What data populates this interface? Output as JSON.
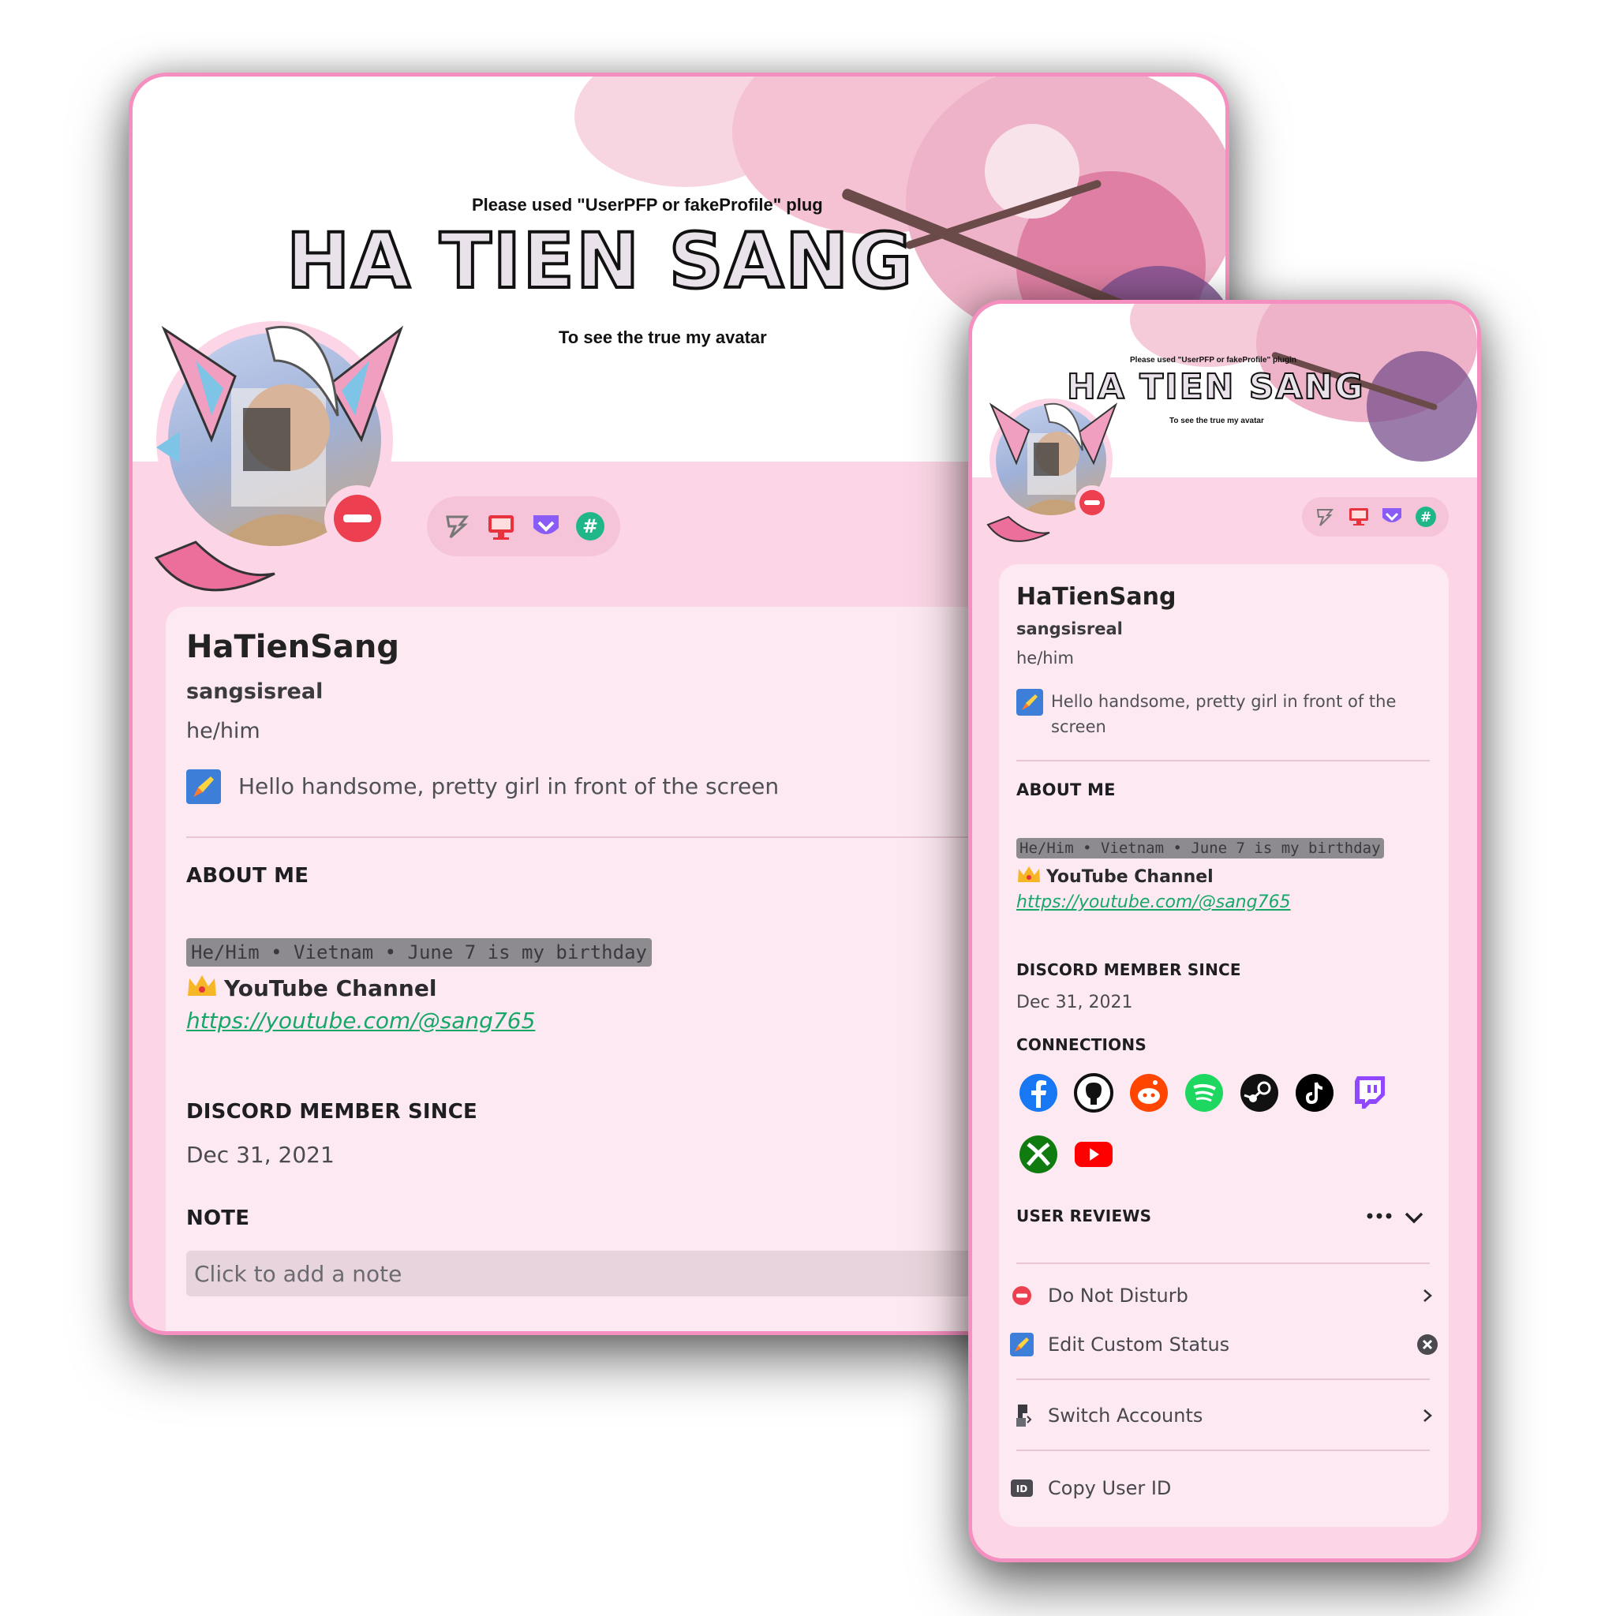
{
  "banner": {
    "caption_top": "Please used \"UserPFP or fakeProfile\" plug",
    "title": "HA TIEN SANG",
    "caption_bottom": "To see the true my avatar",
    "small_caption_top": "Please used \"UserPFP or fakeProfile\" plugin",
    "small_title": "HA TIEN SANG",
    "small_caption_bottom": "To see the true my avatar"
  },
  "profile": {
    "display_name": "HaTienSang",
    "username": "sangsisreal",
    "pronouns": "he/him",
    "custom_status": "Hello handsome, pretty girl in front of the screen",
    "status": "Do Not Disturb"
  },
  "badges": [
    "hypesquad-badge-icon",
    "nitro-desktop-icon",
    "shield-badge-icon",
    "hashtag-badge-icon"
  ],
  "about": {
    "heading": "ABOUT ME",
    "code_line": "He/Him • Vietnam • June 7 is my birthday",
    "yt_label": "YouTube Channel",
    "link": "https://youtube.com/@sang765"
  },
  "member_since": {
    "heading": "DISCORD MEMBER SINCE",
    "date": "Dec 31, 2021"
  },
  "note": {
    "heading": "NOTE",
    "placeholder": "Click to add a note"
  },
  "connections": {
    "heading": "CONNECTIONS",
    "items": [
      "facebook-icon",
      "github-icon",
      "reddit-icon",
      "spotify-icon",
      "steam-icon",
      "tiktok-icon",
      "twitch-icon",
      "xbox-icon",
      "youtube-icon"
    ]
  },
  "reviews": {
    "heading": "USER REVIEWS"
  },
  "menu": {
    "dnd": "Do Not Disturb",
    "edit_status": "Edit Custom Status",
    "switch": "Switch Accounts",
    "copy_id": "Copy User ID"
  },
  "colors": {
    "card_bg": "#fcd6e6",
    "border": "#f58fbf",
    "panel": "#fde9f1",
    "dnd": "#ec3f4f",
    "link": "#17a769"
  }
}
